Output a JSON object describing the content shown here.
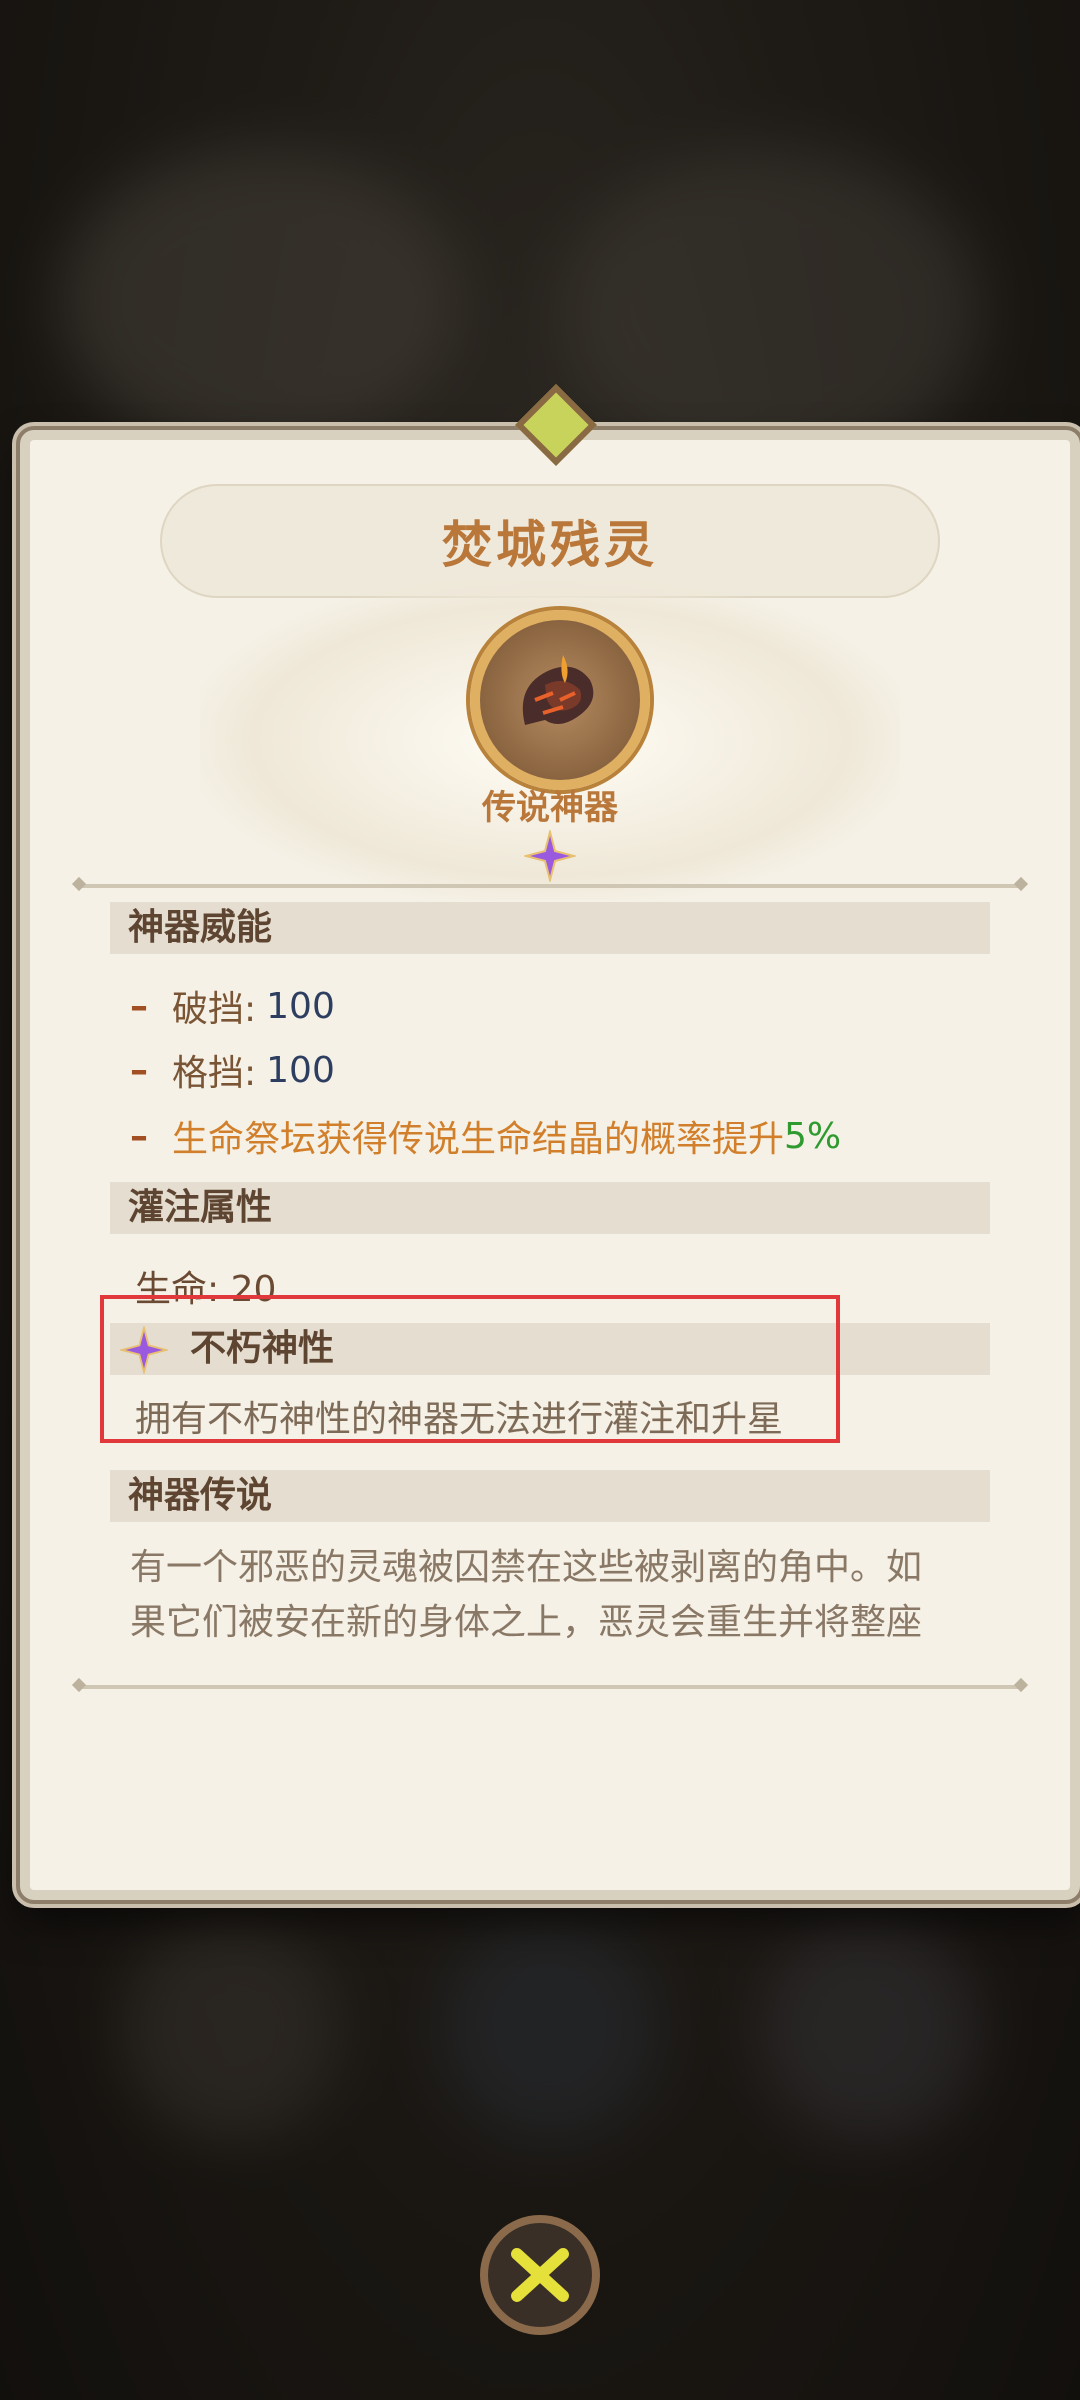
{
  "card": {
    "title": "焚城残灵",
    "rarity": "传说神器"
  },
  "sections": {
    "power": {
      "header": "神器威能",
      "stats": [
        {
          "label": "破挡:",
          "value": "100"
        },
        {
          "label": "格挡:",
          "value": "100"
        }
      ],
      "bonus_text": "生命祭坛获得传说生命结晶的概率提升",
      "bonus_value": "5%"
    },
    "infuse": {
      "header": "灌注属性",
      "value_text": "生命: 20"
    },
    "immortal": {
      "header": "不朽神性",
      "desc": "拥有不朽神性的神器无法进行灌注和升星"
    },
    "lore": {
      "header": "神器传说",
      "line1": "有一个邪恶的灵魂被囚禁在这些被剥离的角中。如",
      "line2": "果它们被安在新的身体之上，恶灵会重生并将整座"
    }
  },
  "colors": {
    "title": "#b9773a",
    "value_blue": "#2e3e60",
    "bonus_orange": "#d17f2b",
    "bonus_green": "#2f9a2f",
    "highlight_red": "#e0383b",
    "arrow_yellow": "#e6e03a"
  },
  "icons": {
    "artifact": "horn-artifact-icon",
    "rarity_star": "purple-star-icon",
    "nav_prev": "chevron-left-icon",
    "nav_next": "chevron-right-icon",
    "close": "close-icon"
  }
}
